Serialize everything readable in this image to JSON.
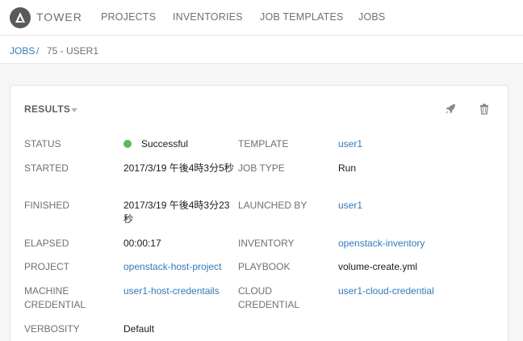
{
  "header": {
    "brand": "TOWER",
    "nav": [
      "PROJECTS",
      "INVENTORIES",
      "JOB TEMPLATES",
      "JOBS"
    ]
  },
  "breadcrumb": {
    "link": "JOBS",
    "separator": "/",
    "current": "75 - USER1"
  },
  "results": {
    "title": "RESULTS",
    "status_label": "STATUS",
    "status_value": "Successful",
    "status_color": "#5cb85c",
    "started_label": "STARTED",
    "started_value": "2017/3/19 午後4時3分5秒",
    "finished_label": "FINISHED",
    "finished_value": "2017/3/19 午後4時3分23秒",
    "elapsed_label": "ELAPSED",
    "elapsed_value": "00:00:17",
    "project_label": "PROJECT",
    "project_value": "openstack-host-project",
    "machine_credential_label": "MACHINE CREDENTIAL",
    "machine_credential_value": "user1-host-credentails",
    "verbosity_label": "VERBOSITY",
    "verbosity_value": "Default",
    "template_label": "TEMPLATE",
    "template_value": "user1",
    "job_type_label": "JOB TYPE",
    "job_type_value": "Run",
    "launched_by_label": "LAUNCHED BY",
    "launched_by_value": "user1",
    "inventory_label": "INVENTORY",
    "inventory_value": "openstack-inventory",
    "playbook_label": "PLAYBOOK",
    "playbook_value": "volume-create.yml",
    "cloud_credential_label": "CLOUD CREDENTIAL",
    "cloud_credential_value": "user1-cloud-credential"
  },
  "colors": {
    "accent": "#337ab7",
    "label": "#707070"
  },
  "icons": [
    "ansible-logo-icon",
    "rocket-icon",
    "trash-icon"
  ]
}
